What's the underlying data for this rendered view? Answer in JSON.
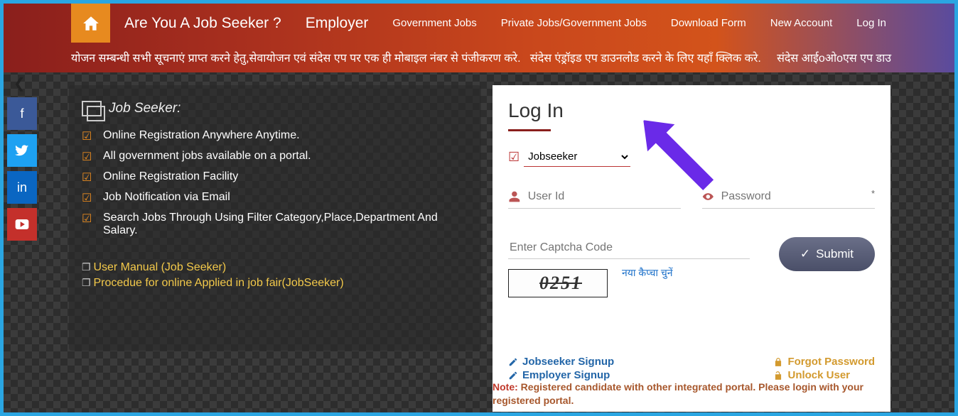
{
  "nav": {
    "job_seeker_q": "Are You A Job Seeker ?",
    "employer": "Employer",
    "gov_jobs": "Government Jobs",
    "priv_gov_jobs": "Private Jobs/Government Jobs",
    "download_form": "Download Form",
    "new_account": "New Account",
    "login": "Log In"
  },
  "marquee": "योजन सम्बन्धी सभी सूचनाएं प्राप्त करने हेतु,सेवायोजन एवं संदेस एप पर एक ही मोबाइल नंबर से पंजीकरण करे.   संदेस एंड्रॉइड एप डाउनलोड करने के लिए यहाँ क्लिक करे.     संदेस आईoओoएस एप डाउ",
  "left": {
    "title": "Job Seeker:",
    "items": [
      "Online Registration Anywhere Anytime.",
      "All government jobs available on a portal.",
      "Online Registration Facility",
      "Job Notification via Email",
      "Search Jobs Through Using Filter Category,Place,Department And Salary."
    ],
    "links": [
      "User Manual (Job Seeker)",
      "Procedue for online Applied in job fair(JobSeeker)"
    ]
  },
  "login": {
    "title": "Log In",
    "role_selected": "Jobseeker",
    "user_id_placeholder": "User Id",
    "password_placeholder": "Password",
    "captcha_placeholder": "Enter Captcha Code",
    "captcha_value": "0251",
    "new_captcha": "नया कैप्चा चुनें",
    "submit": "Submit",
    "jobseeker_signup": "Jobseeker  Signup",
    "employer_signup": "Employer  Signup",
    "forgot_password": "Forgot Password",
    "unlock_user": "Unlock User",
    "note_prefix": "Note: ",
    "note_body": "Registered candidate with other integrated portal. Please login with your registered portal."
  }
}
